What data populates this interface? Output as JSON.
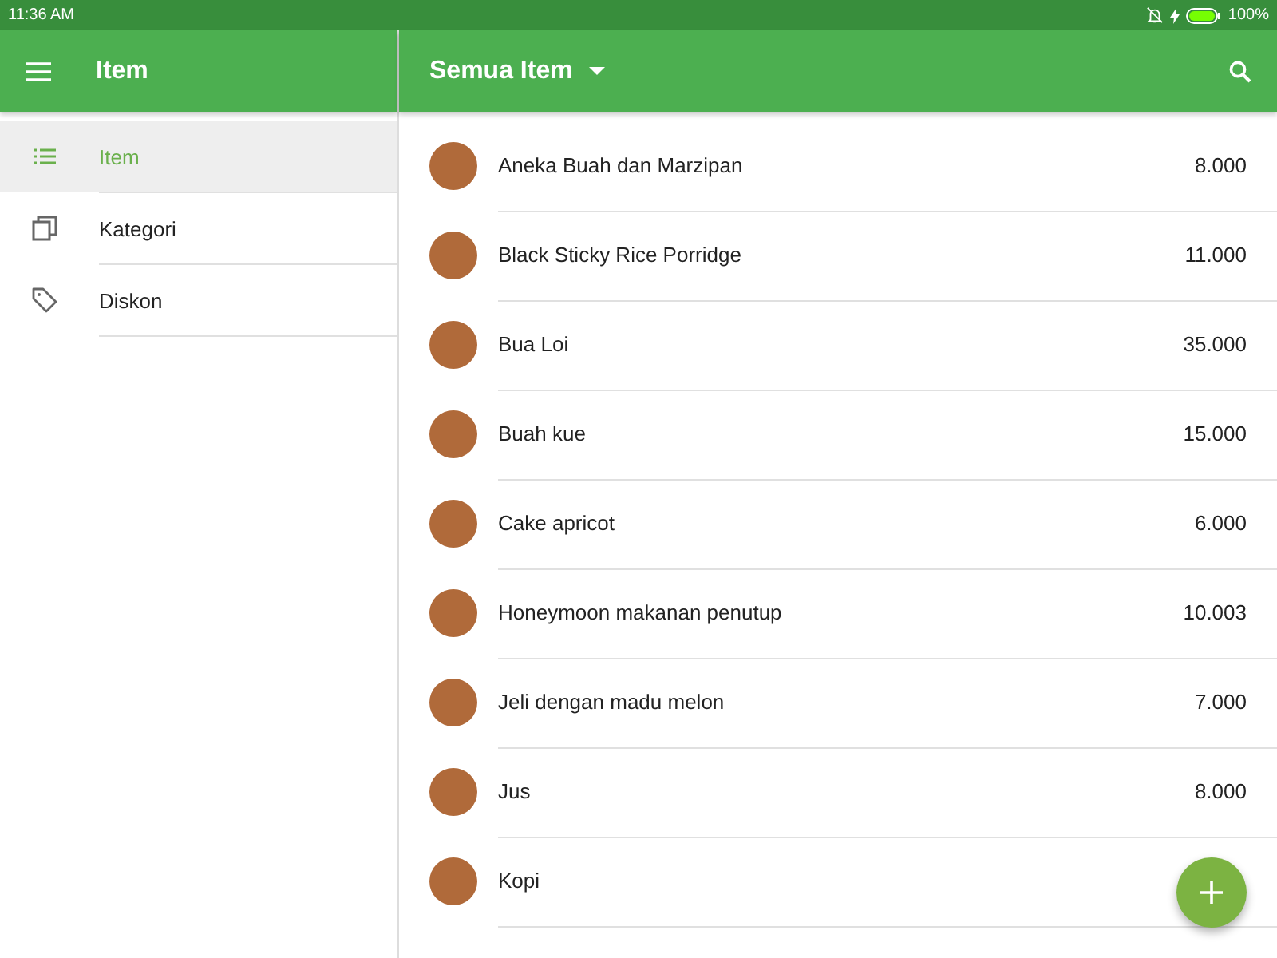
{
  "status_bar": {
    "time": "11:36 AM",
    "battery": "100%"
  },
  "sidebar": {
    "title": "Item",
    "items": [
      {
        "label": "Item",
        "kind": "list",
        "selected": true
      },
      {
        "label": "Kategori",
        "kind": "stack",
        "selected": false
      },
      {
        "label": "Diskon",
        "kind": "tag",
        "selected": false
      }
    ]
  },
  "toolbar": {
    "title": "Semua Item"
  },
  "items": [
    {
      "name": "Aneka Buah dan Marzipan",
      "price": "8.000"
    },
    {
      "name": "Black Sticky Rice Porridge",
      "price": "11.000"
    },
    {
      "name": "Bua Loi",
      "price": "35.000"
    },
    {
      "name": "Buah kue",
      "price": "15.000"
    },
    {
      "name": "Cake apricot",
      "price": "6.000"
    },
    {
      "name": "Honeymoon makanan penutup",
      "price": "10.003"
    },
    {
      "name": "Jeli dengan madu melon",
      "price": "7.000"
    },
    {
      "name": "Jus",
      "price": "8.000"
    },
    {
      "name": "Kopi"
    }
  ]
}
